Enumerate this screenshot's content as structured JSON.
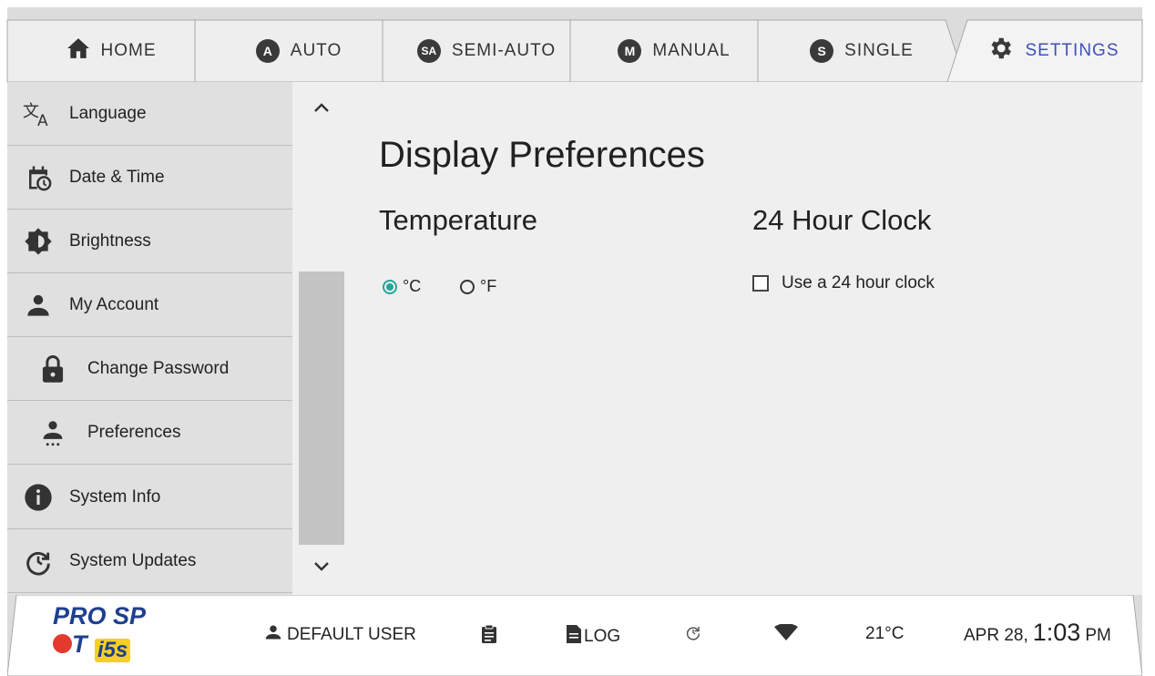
{
  "tabs": [
    {
      "label": "HOME",
      "icon": "home-icon"
    },
    {
      "label": "AUTO",
      "icon": "auto-icon",
      "badge": "A"
    },
    {
      "label": "SEMI-AUTO",
      "icon": "semi-auto-icon",
      "badge": "SA"
    },
    {
      "label": "MANUAL",
      "icon": "manual-icon",
      "badge": "M"
    },
    {
      "label": "SINGLE",
      "icon": "single-icon",
      "badge": "S"
    },
    {
      "label": "SETTINGS",
      "icon": "gear-icon",
      "active": true
    }
  ],
  "sidebar": {
    "items": [
      {
        "label": "Language",
        "icon": "translate-icon"
      },
      {
        "label": "Date & Time",
        "icon": "calendar-clock-icon"
      },
      {
        "label": "Brightness",
        "icon": "brightness-icon"
      },
      {
        "label": "My Account",
        "icon": "person-icon"
      },
      {
        "label": "Change Password",
        "icon": "lock-icon"
      },
      {
        "label": "Preferences",
        "icon": "person-settings-icon"
      },
      {
        "label": "System Info",
        "icon": "info-icon"
      },
      {
        "label": "System Updates",
        "icon": "update-icon"
      }
    ]
  },
  "main": {
    "title": "Display Preferences",
    "temperature": {
      "heading": "Temperature",
      "options": [
        {
          "label": "°C",
          "selected": true
        },
        {
          "label": "°F",
          "selected": false
        }
      ]
    },
    "clock": {
      "heading": "24 Hour Clock",
      "checkbox_label": "Use a 24 hour clock",
      "checked": false
    }
  },
  "statusbar": {
    "logo_top": "PRO SP",
    "logo_top_end": "T",
    "logo_bottom": "i5s",
    "user": "DEFAULT USER",
    "log": "LOG",
    "temperature": "21°C",
    "date": "APR 28,",
    "time": "1:03",
    "ampm": "PM"
  },
  "colors": {
    "accent": "#3f51b5",
    "radio": "#26a69a",
    "sidebar_bg": "#e0e0e0",
    "content_bg": "#efefef"
  }
}
